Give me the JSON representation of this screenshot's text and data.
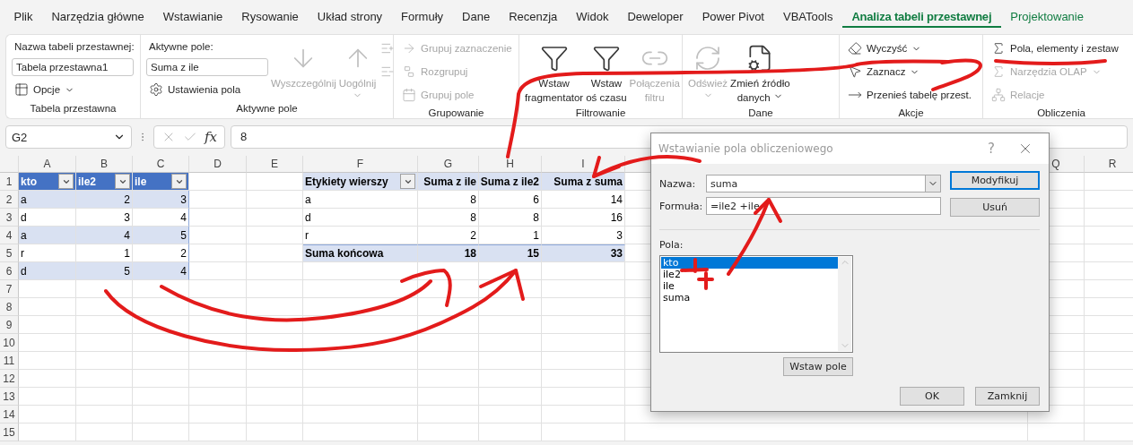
{
  "menu_tabs": [
    {
      "label": "Plik",
      "selected": false,
      "contextual": false
    },
    {
      "label": "Narzędzia główne",
      "selected": false,
      "contextual": false
    },
    {
      "label": "Wstawianie",
      "selected": false,
      "contextual": false
    },
    {
      "label": "Rysowanie",
      "selected": false,
      "contextual": false
    },
    {
      "label": "Układ strony",
      "selected": false,
      "contextual": false
    },
    {
      "label": "Formuły",
      "selected": false,
      "contextual": false
    },
    {
      "label": "Dane",
      "selected": false,
      "contextual": false
    },
    {
      "label": "Recenzja",
      "selected": false,
      "contextual": false
    },
    {
      "label": "Widok",
      "selected": false,
      "contextual": false
    },
    {
      "label": "Deweloper",
      "selected": false,
      "contextual": false
    },
    {
      "label": "Power Pivot",
      "selected": false,
      "contextual": false
    },
    {
      "label": "VBATools",
      "selected": false,
      "contextual": false
    },
    {
      "label": "Analiza tabeli przestawnej",
      "selected": true,
      "contextual": true
    },
    {
      "label": "Projektowanie",
      "selected": false,
      "contextual": true
    }
  ],
  "ribbon": {
    "groups": [
      {
        "label": "Tabela przestawna",
        "columns": [
          [
            {
              "kind": "label",
              "text": "Nazwa tabeli przestawnej:"
            },
            {
              "kind": "input",
              "value": "Tabela przestawna1"
            },
            {
              "kind": "small",
              "text": "Opcje",
              "dropdown": true,
              "disabled": false
            }
          ]
        ]
      },
      {
        "label": "Aktywne pole",
        "columns": [
          [
            {
              "kind": "label",
              "text": "Aktywne pole:"
            },
            {
              "kind": "input",
              "value": "Suma z ile"
            },
            {
              "kind": "small",
              "text": "Ustawienia pola",
              "dropdown": false,
              "disabled": false
            }
          ],
          [
            {
              "kind": "large",
              "lines": [
                "Wyszczególnij"
              ],
              "dropdown": false,
              "disabled": true
            }
          ],
          [
            {
              "kind": "large",
              "lines": [
                "Uogólnij"
              ],
              "dropdown": true,
              "disabled": true
            }
          ],
          [
            {
              "kind": "icon",
              "disabled": true
            },
            {
              "kind": "icon",
              "disabled": true
            }
          ]
        ]
      },
      {
        "label": "Grupowanie",
        "columns": [
          [
            {
              "kind": "small",
              "text": "Grupuj zaznaczenie",
              "dropdown": false,
              "disabled": true
            },
            {
              "kind": "small",
              "text": "Rozgrupuj",
              "dropdown": false,
              "disabled": true
            },
            {
              "kind": "small",
              "text": "Grupuj pole",
              "dropdown": false,
              "disabled": true
            }
          ]
        ]
      },
      {
        "label": "Filtrowanie",
        "columns": [
          [
            {
              "kind": "large",
              "lines": [
                "Wstaw",
                "fragmentator"
              ],
              "dropdown": false,
              "disabled": false
            }
          ],
          [
            {
              "kind": "large",
              "lines": [
                "Wstaw",
                "oś czasu"
              ],
              "dropdown": false,
              "disabled": false
            }
          ],
          [
            {
              "kind": "large",
              "lines": [
                "Połączenia",
                "filtru"
              ],
              "dropdown": false,
              "disabled": true
            }
          ]
        ]
      },
      {
        "label": "Dane",
        "columns": [
          [
            {
              "kind": "large",
              "lines": [
                "Odśwież"
              ],
              "dropdown": true,
              "disabled": true
            }
          ],
          [
            {
              "kind": "large",
              "lines": [
                "Zmień źródło",
                "danych"
              ],
              "dropdown": true,
              "disabled": false
            }
          ]
        ]
      },
      {
        "label": "Akcje",
        "columns": [
          [
            {
              "kind": "small",
              "text": "Wyczyść",
              "dropdown": true,
              "disabled": false
            },
            {
              "kind": "small",
              "text": "Zaznacz",
              "dropdown": true,
              "disabled": false
            },
            {
              "kind": "small",
              "text": "Przenieś tabelę przest.",
              "dropdown": false,
              "disabled": false
            }
          ]
        ]
      },
      {
        "label": "Obliczenia",
        "columns": [
          [
            {
              "kind": "small",
              "text": "Pola, elementy i zestaw",
              "dropdown": false,
              "disabled": false
            },
            {
              "kind": "small",
              "text": "Narzędzia OLAP",
              "dropdown": true,
              "disabled": true
            },
            {
              "kind": "small",
              "text": "Relacje",
              "dropdown": false,
              "disabled": true
            }
          ]
        ]
      }
    ]
  },
  "formula_bar": {
    "name_box": "G2",
    "function_label": "fx",
    "formula": "8"
  },
  "sheet": {
    "columns": [
      {
        "label": "A"
      },
      {
        "label": "B"
      },
      {
        "label": "C"
      },
      {
        "label": "D"
      },
      {
        "label": "E"
      },
      {
        "label": "F"
      },
      {
        "label": "G"
      },
      {
        "label": "H"
      },
      {
        "label": "I"
      },
      {
        "label": "Q"
      },
      {
        "label": "R"
      }
    ],
    "row_numbers": [
      "1",
      "2",
      "3",
      "4",
      "5",
      "6",
      "7",
      "8",
      "9",
      "10",
      "11",
      "12",
      "13",
      "14",
      "15"
    ],
    "source_table": {
      "headers": [
        "kto",
        "ile2",
        "ile"
      ],
      "rows": [
        [
          "a",
          "2",
          "3"
        ],
        [
          "d",
          "3",
          "4"
        ],
        [
          "a",
          "4",
          "5"
        ],
        [
          "r",
          "1",
          "2"
        ],
        [
          "d",
          "5",
          "4"
        ]
      ]
    },
    "pivot_table": {
      "headers": [
        "Etykiety wierszy",
        "Suma z ile",
        "Suma z ile2",
        "Suma z suma"
      ],
      "rows": [
        [
          "a",
          "8",
          "6",
          "14"
        ],
        [
          "d",
          "8",
          "8",
          "16"
        ],
        [
          "r",
          "2",
          "1",
          "3"
        ]
      ],
      "total": [
        "Suma końcowa",
        "18",
        "15",
        "33"
      ]
    }
  },
  "dialog": {
    "title": "Wstawianie pola obliczeniowego",
    "help": "?",
    "name_label": "Nazwa:",
    "name_value": "suma",
    "formula_label": "Formuła:",
    "formula_value": "=ile2 +ile",
    "fields_label": "Pola:",
    "fields": [
      {
        "label": "kto",
        "selected": true
      },
      {
        "label": "ile2",
        "selected": false
      },
      {
        "label": "ile",
        "selected": false
      },
      {
        "label": "suma",
        "selected": false
      }
    ],
    "side_buttons": [
      {
        "label": "Modyfikuj",
        "default": true
      },
      {
        "label": "Usuń",
        "default": false
      }
    ],
    "insert_button": "Wstaw pole",
    "footer_buttons": [
      "OK",
      "Zamknij"
    ]
  }
}
